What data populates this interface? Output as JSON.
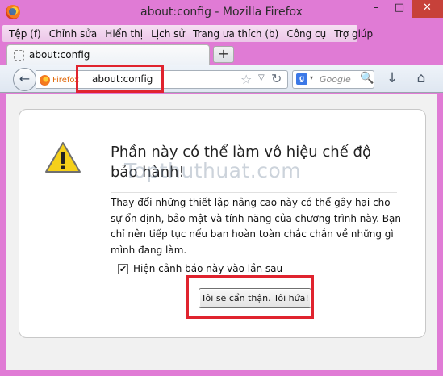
{
  "window": {
    "title": "about:config - Mozilla Firefox",
    "minimize": "–",
    "maximize": "□",
    "close": "✕"
  },
  "menu": [
    "Tệp (f)",
    "Chỉnh sửa",
    "Hiển thị",
    "Lịch sử",
    "Trang ưa thích (b)",
    "Công cụ",
    "Trợ giúp"
  ],
  "tabs": [
    {
      "label": "about:config"
    }
  ],
  "new_tab": "+",
  "navbar": {
    "back": "←",
    "identity_label": "Firefox",
    "url": "about:config",
    "star": "☆",
    "dropdown": "▽",
    "reload": "↻",
    "search_engine": "g",
    "search_caret": "▾",
    "search_placeholder": "Google",
    "search_go": "🔍",
    "download": "↓",
    "home": "⌂"
  },
  "warning": {
    "title": "Phần này có thể làm vô hiệu chế độ bảo hành!",
    "body": "Thay đổi những thiết lập nâng cao này có thể gây hại cho sự ổn định, bảo mật và tính năng của chương trình này. Bạn chỉ nên tiếp tục nếu bạn hoàn toàn chắc chắn về những gì mình đang làm.",
    "checkbox_label": "Hiện cảnh báo này vào lần sau",
    "checkbox_checked": true,
    "checkmark": "✔",
    "confirm_button": "Tôi sẽ cẩn thận. Tôi hứa!"
  },
  "watermark": "Topthuthuat.com",
  "colors": {
    "frame": "#e07bd5",
    "highlight": "#e0232e",
    "close": "#c7413a"
  }
}
